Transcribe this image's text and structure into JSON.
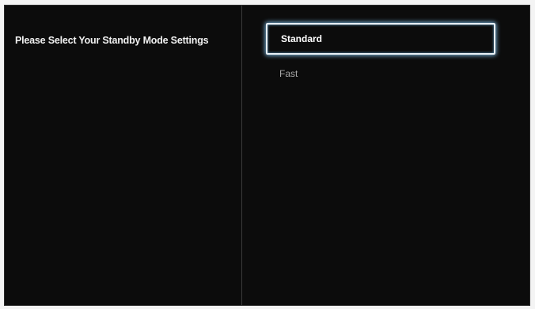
{
  "settings": {
    "prompt": "Please Select Your Standby Mode Settings",
    "options": [
      {
        "label": "Standard",
        "selected": true
      },
      {
        "label": "Fast",
        "selected": false
      }
    ]
  },
  "colors": {
    "background": "#0c0c0c",
    "focus_border": "#e8f0f6",
    "focus_glow": "#7bb6de",
    "text_active": "#ffffff",
    "text_inactive": "#a8a8a8"
  }
}
